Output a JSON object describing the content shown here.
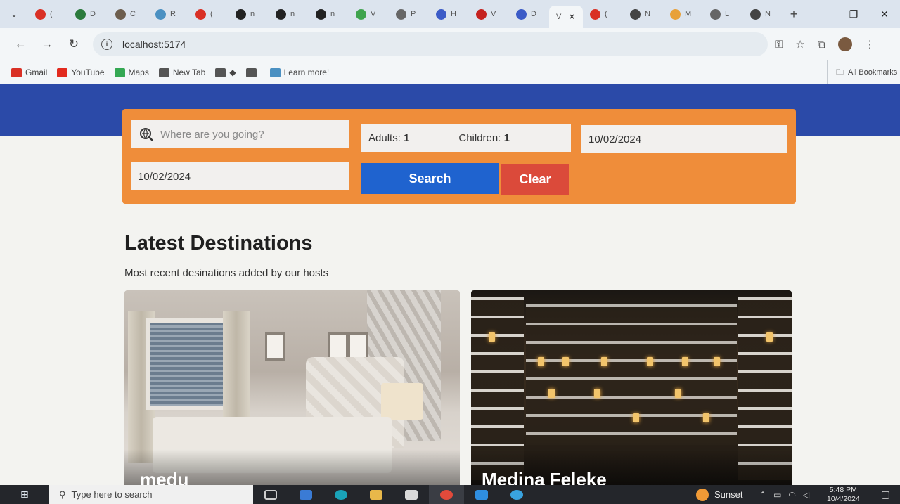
{
  "browser": {
    "tabs": [
      {
        "label": "(",
        "color": "#d93025"
      },
      {
        "label": "D",
        "color": "#2b7a3c"
      },
      {
        "label": "C",
        "color": "#6d5e4e"
      },
      {
        "label": "R",
        "color": "#4a90c2"
      },
      {
        "label": "(",
        "color": "#d93025"
      },
      {
        "label": "n",
        "color": "#222222"
      },
      {
        "label": "n",
        "color": "#222222"
      },
      {
        "label": "n",
        "color": "#222222"
      },
      {
        "label": "V",
        "color": "#3fa34d"
      },
      {
        "label": "P",
        "color": "#666666"
      },
      {
        "label": "H",
        "color": "#3b5bc7"
      },
      {
        "label": "V",
        "color": "#c5221f"
      },
      {
        "label": "D",
        "color": "#3b5bc7"
      }
    ],
    "active_tab": {
      "label": "V",
      "close": "✕"
    },
    "tabs_after": [
      {
        "label": "(",
        "color": "#d93025"
      },
      {
        "label": "N",
        "color": "#444444"
      },
      {
        "label": "M",
        "color": "#e8a13a"
      },
      {
        "label": "L",
        "color": "#666666"
      },
      {
        "label": "N",
        "color": "#444444"
      }
    ],
    "new_tab": "+",
    "window_controls": {
      "minimize": "—",
      "restore": "❐",
      "close": "✕"
    },
    "nav": {
      "back": "←",
      "forward": "→",
      "reload": "↻"
    },
    "url": "localhost:5174",
    "bookmarks": [
      {
        "label": "Gmail",
        "color": "#d93025"
      },
      {
        "label": "YouTube",
        "color": "#e22a1e"
      },
      {
        "label": "Maps",
        "color": "#34a853"
      },
      {
        "label": "New Tab",
        "color": "#555555"
      },
      {
        "label": "◆",
        "color": "#555555"
      },
      {
        "label": "",
        "color": "#555555"
      },
      {
        "label": "Learn more!",
        "color": "#4a90c2"
      }
    ],
    "all_bookmarks": "All Bookmarks"
  },
  "search": {
    "destination_placeholder": "Where are you going?",
    "adults_label": "Adults:",
    "adults_value": "1",
    "children_label": "Children:",
    "children_value": "1",
    "check_in": "10/02/2024",
    "check_out": "10/02/2024",
    "search_button": "Search",
    "clear_button": "Clear"
  },
  "section": {
    "title": "Latest Destinations",
    "subtitle": "Most recent desinations added by our hosts"
  },
  "destinations": [
    {
      "name": "medu"
    },
    {
      "name": "Medina Feleke"
    }
  ],
  "taskbar": {
    "start": "⊞",
    "search_placeholder": "Type here to search",
    "weather": "Sunset",
    "time": "5:48 PM",
    "date": "10/4/2024"
  },
  "colors": {
    "hero": "#2b4aa8",
    "search_panel": "#ef8d3a",
    "search_button": "#1f63cf",
    "clear_button": "#db4a3a"
  }
}
